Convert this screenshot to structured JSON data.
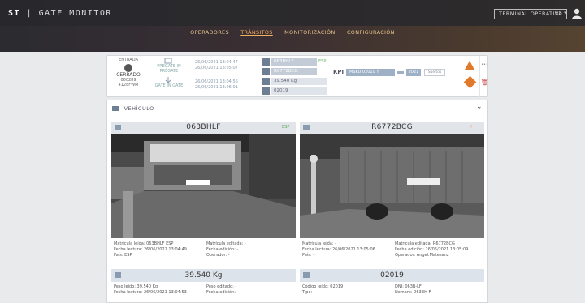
{
  "header": {
    "brand_st": "ST",
    "brand_text": "GATE MONITOR",
    "terminal_button": "TERMINAL OPERATIVA",
    "lang": "ES ▾"
  },
  "nav": {
    "items": [
      "OPERADORES",
      "TRÁNSITOS",
      "MONITORIZACIÓN",
      "CONFIGURACIÓN"
    ],
    "active": 1
  },
  "summary": {
    "gate_label": "ENTRADA",
    "state": "CERRADO",
    "state_sub1": "060289",
    "state_sub2": "4128FWM",
    "events": [
      {
        "label": "PREGATE IN\nPRÉGATE",
        "t1": "26/06/2021 13:04:47",
        "t2": "26/06/2021 13:05:07"
      },
      {
        "label": "GATE IN\nGATE",
        "t1": "26/06/2021 13:04:56",
        "t2": "26/06/2021 13:06:01"
      }
    ],
    "plates": [
      {
        "value": "063BHLF",
        "flag": "ESP"
      },
      {
        "value": "R6772BCG",
        "flag": ""
      },
      {
        "value": "39.540 Kg",
        "flag": ""
      },
      {
        "value": "02019",
        "flag": ""
      }
    ],
    "kpi_label": "KPI",
    "bar1": "MSKU 0201G F",
    "bar2": "2021",
    "bar3": "Sueltos"
  },
  "vehicle": {
    "title": "VEHÍCULO",
    "tractor": {
      "plate": "063BHLF",
      "tag": "ESP",
      "read_label": "Matrícula leída: 063BHLF ESP",
      "read_time": "Fecha lectura: 26/06/2021 13:04:49",
      "country": "País: ESP",
      "edited_label": "Matrícula editada: -",
      "edited_time": "Fecha edición: -",
      "operator": "Operador: -"
    },
    "trailer": {
      "plate": "R6772BCG",
      "tag": "!",
      "read_label": "Matrícula leída: -",
      "read_time": "Fecha lectura: 26/06/2021 13:05:06",
      "country": "País: -",
      "edited_label": "Matrícula editada: R6772BCG",
      "edited_time": "Fecha edición: 26/06/2021 13:05:09",
      "operator": "Operador: Angel.Matesanz"
    },
    "weight": {
      "value": "39.540 Kg",
      "read": "Peso leído: 39.540 Kg",
      "read_time": "Fecha lectura: 26/06/2021 13:04:53",
      "edited": "Peso editado: -",
      "edited_time": "Fecha edición: -"
    },
    "driver": {
      "value": "02019",
      "code": "Código leído: 02019",
      "type": "Tipo: -",
      "dni": "DNI: 063B-LF",
      "name": "Nombre: 063BH F"
    }
  }
}
